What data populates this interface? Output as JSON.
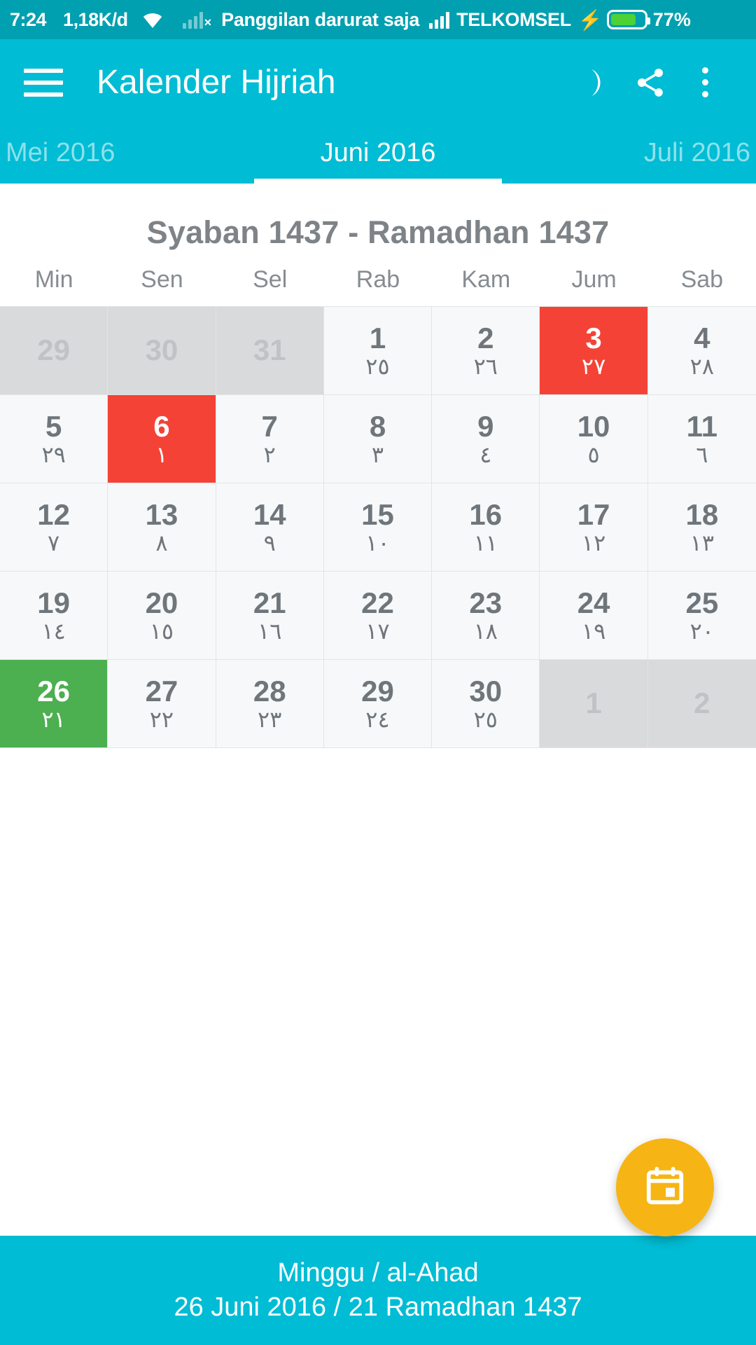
{
  "status_bar": {
    "time": "7:24",
    "data_rate": "1,18K/d",
    "network_message": "Panggilan darurat saja",
    "carrier": "TELKOMSEL",
    "battery_percent": "77%",
    "battery_level": 77,
    "icons": [
      "wifi-icon",
      "signal-bars-dim-icon",
      "signal-bars-icon",
      "charging-bolt-icon",
      "battery-icon"
    ],
    "colors": {
      "background": "#00A0B0",
      "battery_fill": "#4CD137"
    }
  },
  "app_bar": {
    "title": "Kalender Hijriah",
    "menu_icon": "hamburger-menu-icon",
    "moon_icon": "moon-icon",
    "share_icon": "share-icon",
    "overflow_icon": "overflow-menu-icon",
    "background": "#00BCD4"
  },
  "tabs": {
    "items": [
      {
        "label": "Mei 2016",
        "active": false
      },
      {
        "label": "Juni 2016",
        "active": true
      },
      {
        "label": "Juli 2016",
        "active": false
      }
    ]
  },
  "calendar": {
    "hijri_title": "Syaban 1437 - Ramadhan 1437",
    "weekdays": [
      "Min",
      "Sen",
      "Sel",
      "Rab",
      "Kam",
      "Jum",
      "Sab"
    ],
    "cells": [
      {
        "gregorian": "29",
        "hijri": "",
        "state": "out"
      },
      {
        "gregorian": "30",
        "hijri": "",
        "state": "out"
      },
      {
        "gregorian": "31",
        "hijri": "",
        "state": "out"
      },
      {
        "gregorian": "1",
        "hijri": "٢٥",
        "state": "normal"
      },
      {
        "gregorian": "2",
        "hijri": "٢٦",
        "state": "normal"
      },
      {
        "gregorian": "3",
        "hijri": "٢٧",
        "state": "red"
      },
      {
        "gregorian": "4",
        "hijri": "٢٨",
        "state": "normal"
      },
      {
        "gregorian": "5",
        "hijri": "٢٩",
        "state": "normal"
      },
      {
        "gregorian": "6",
        "hijri": "١",
        "state": "red"
      },
      {
        "gregorian": "7",
        "hijri": "٢",
        "state": "normal"
      },
      {
        "gregorian": "8",
        "hijri": "٣",
        "state": "normal"
      },
      {
        "gregorian": "9",
        "hijri": "٤",
        "state": "normal"
      },
      {
        "gregorian": "10",
        "hijri": "٥",
        "state": "normal"
      },
      {
        "gregorian": "11",
        "hijri": "٦",
        "state": "normal"
      },
      {
        "gregorian": "12",
        "hijri": "٧",
        "state": "normal"
      },
      {
        "gregorian": "13",
        "hijri": "٨",
        "state": "normal"
      },
      {
        "gregorian": "14",
        "hijri": "٩",
        "state": "normal"
      },
      {
        "gregorian": "15",
        "hijri": "١٠",
        "state": "normal"
      },
      {
        "gregorian": "16",
        "hijri": "١١",
        "state": "normal"
      },
      {
        "gregorian": "17",
        "hijri": "١٢",
        "state": "normal"
      },
      {
        "gregorian": "18",
        "hijri": "١٣",
        "state": "normal"
      },
      {
        "gregorian": "19",
        "hijri": "١٤",
        "state": "normal"
      },
      {
        "gregorian": "20",
        "hijri": "١٥",
        "state": "normal"
      },
      {
        "gregorian": "21",
        "hijri": "١٦",
        "state": "normal"
      },
      {
        "gregorian": "22",
        "hijri": "١٧",
        "state": "normal"
      },
      {
        "gregorian": "23",
        "hijri": "١٨",
        "state": "normal"
      },
      {
        "gregorian": "24",
        "hijri": "١٩",
        "state": "normal"
      },
      {
        "gregorian": "25",
        "hijri": "٢٠",
        "state": "normal"
      },
      {
        "gregorian": "26",
        "hijri": "٢١",
        "state": "green"
      },
      {
        "gregorian": "27",
        "hijri": "٢٢",
        "state": "normal"
      },
      {
        "gregorian": "28",
        "hijri": "٢٣",
        "state": "normal"
      },
      {
        "gregorian": "29",
        "hijri": "٢٤",
        "state": "normal"
      },
      {
        "gregorian": "30",
        "hijri": "٢٥",
        "state": "normal"
      },
      {
        "gregorian": "1",
        "hijri": "",
        "state": "out"
      },
      {
        "gregorian": "2",
        "hijri": "",
        "state": "out"
      }
    ],
    "colors": {
      "holiday": "#F44336",
      "selected": "#4CAF50",
      "outside_month": "#D8DADB",
      "cell_background": "#F7F8F9"
    }
  },
  "bottom_bar": {
    "line1": "Minggu / al-Ahad",
    "line2": "26 Juni 2016 / 21 Ramadhan 1437",
    "background": "#00BCD4"
  },
  "fab": {
    "icon": "calendar-today-icon",
    "color": "#F6B514"
  }
}
